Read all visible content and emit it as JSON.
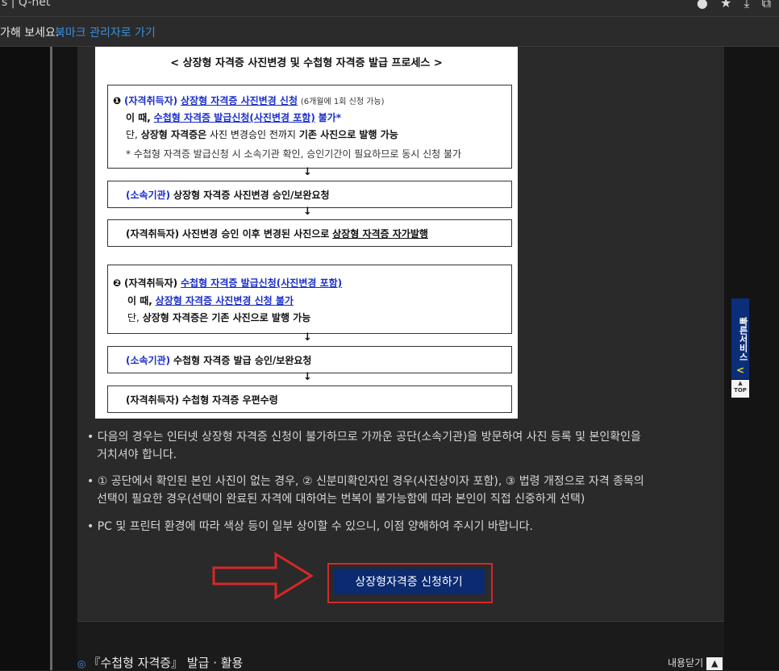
{
  "browser": {
    "tab_title": "s | Q-net",
    "bookmark_prompt": "가해 보세요.",
    "bookmark_link": "북마크 관리자로 가기"
  },
  "diagram": {
    "title": "< 상장형 자격증 사진변경 및 수첩형 자격증 발급 프로세스 >",
    "box1": {
      "marker": "❶",
      "l1_role": "(자격취득자)",
      "l1_action": "상장형 자격증 사진변경 신청",
      "l1_note": "(6개월에 1회 신청 가능)",
      "l2_prefix": "이 때,",
      "l2_mid": "수첩형 자격증 발급신청(사진변경 포함)",
      "l2_suffix": "불가*",
      "l3_prefix": "단,",
      "l3_bold": "상장형 자격증은",
      "l3_mid": "사진 변경승인 전까지",
      "l3_end": "기존 사진으로 발행 가능",
      "l4": "* 수첩형 자격증 발급신청 시 소속기관 확인, 승인기간이 필요하므로 동시 신청 불가"
    },
    "box2": {
      "role": "(소속기관)",
      "text": "상장형 자격증 사진변경 승인/보완요청"
    },
    "box3": {
      "role": "(자격취득자)",
      "text": "사진변경 승인 이후 변경된 사진으로",
      "end": "상장형 자격증 자가발행"
    },
    "box4": {
      "marker": "❷",
      "l1_role": "(자격취득자)",
      "l1_action": "수첩형 자격증 발급신청(사진변경 포함)",
      "l2_prefix": "이 때,",
      "l2_text": "상장형 자격증 사진변경 신청 불가",
      "l3_prefix": "단,",
      "l3_text": "상장형 자격증은 기존 사진으로 발행 가능"
    },
    "box5": {
      "role": "(소속기관)",
      "text": "수첩형 자격증 발급 승인/보완요청"
    },
    "box6": {
      "role": "(자격취득자)",
      "text": "수첩형 자격증 우편수령"
    },
    "arrow_glyph": "↓"
  },
  "notes": [
    "다음의 경우는 인터넷 상장형 자격증 신청이 불가하므로 가까운 공단(소속기관)을 방문하여 사진 등록 및 본인확인을",
    "거치셔야 합니다.",
    "① 공단에서 확인된 본인 사진이 없는 경우, ② 신분미확인자인 경우(사진상이자 포함), ③ 법령 개정으로 자격 종목의",
    "선택이 필요한 경우(선택이 완료된 자격에 대하여는 번복이 불가능함에 따라 본인이 직접 신중하게 선택)",
    "PC 및 프린터 환경에 따라 색상 등이 일부 상이할 수 있으니, 이점 양해하여 주시기 바랍니다."
  ],
  "apply_button": "상장형자격증 신청하기",
  "section_title": "『수첩형 자격증』 발급 · 활용",
  "close_label": "내용닫기",
  "quick_service": "빠른서비스",
  "top_label": "TOP"
}
